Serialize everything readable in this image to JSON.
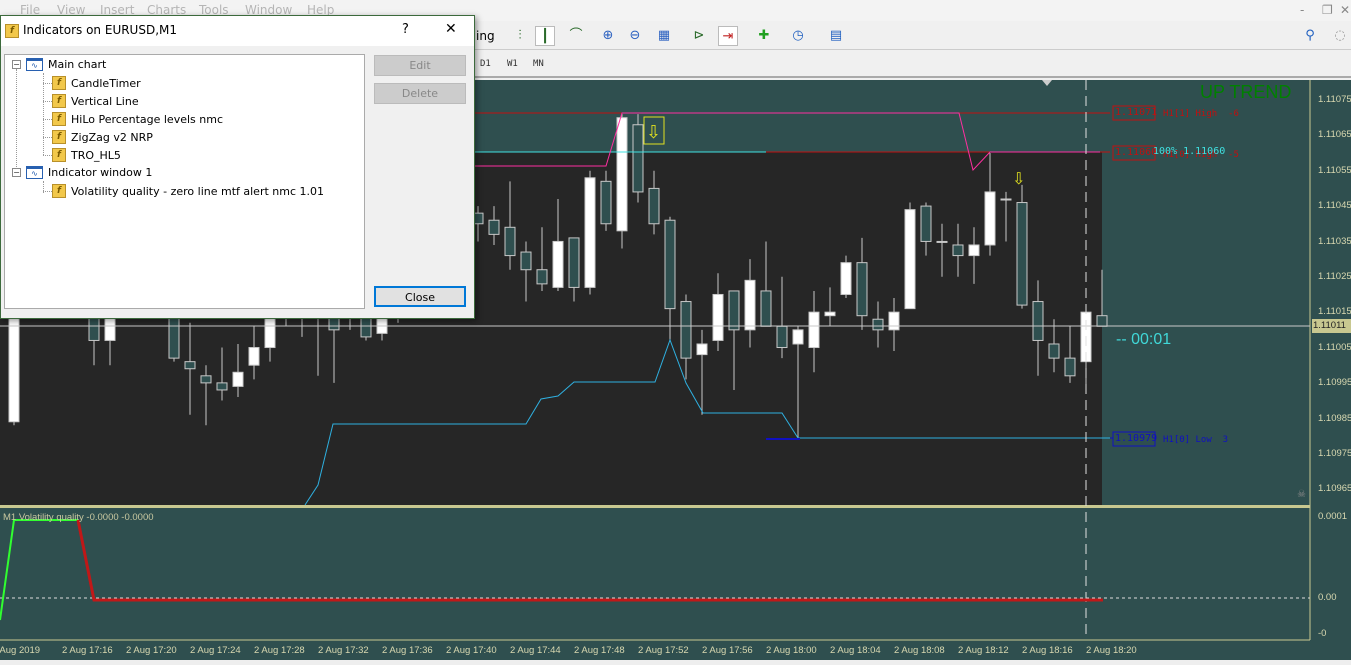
{
  "menu": {
    "items": [
      "File",
      "View",
      "Insert",
      "Charts",
      "Tools",
      "Window",
      "Help"
    ]
  },
  "toolbar": {
    "autotrading_fragment": "ing",
    "icons": [
      "bar-chart-icon",
      "candlestick-icon",
      "line-chart-icon",
      "zoom-in-icon",
      "zoom-out-icon",
      "tile-windows-icon",
      "chart-shift-icon",
      "autoscroll-icon",
      "new-indicator-icon",
      "periods-icon",
      "templates-icon",
      "search-icon",
      "community-icon"
    ]
  },
  "timeframes": [
    "D1",
    "W1",
    "MN"
  ],
  "dialog": {
    "title": "Indicators on EURUSD,M1",
    "help": "?",
    "close_x": "✕",
    "tree": [
      {
        "label": "Main chart",
        "children": [
          "CandleTimer",
          "Vertical Line",
          "HiLo Percentage levels nmc",
          "ZigZag v2 NRP",
          "TRO_HL5"
        ]
      },
      {
        "label": "Indicator window 1",
        "children": [
          "Volatility quality - zero line mtf alert nmc 1.01"
        ]
      }
    ],
    "edit": "Edit",
    "delete": "Delete",
    "close": "Close"
  },
  "chart": {
    "symbol": "EURUSD",
    "timeframe": "M1",
    "trend_label": "UP TREND",
    "timer": "-- 00:01",
    "levels": {
      "h1_1_high": {
        "price": "1.11071",
        "label": "H1[1] High  -6"
      },
      "h1_0_high": {
        "price": "1.11060",
        "label": "H1[0] High  -5"
      },
      "pct100": "100% 1.11060",
      "h1_0_low": {
        "price": "1.10979",
        "label": "H1[0] Low  3"
      }
    },
    "price_axis": [
      "1.11075",
      "1.11065",
      "1.11055",
      "1.11045",
      "1.11035",
      "1.11025",
      "1.11015",
      "1.11005",
      "1.10995",
      "1.10985",
      "1.10975",
      "1.10965"
    ],
    "current_price": "1.11011",
    "time_axis": [
      "2 Aug 2019",
      "2 Aug 17:16",
      "2 Aug 17:20",
      "2 Aug 17:24",
      "2 Aug 17:28",
      "2 Aug 17:32",
      "2 Aug 17:36",
      "2 Aug 17:40",
      "2 Aug 17:44",
      "2 Aug 17:48",
      "2 Aug 17:52",
      "2 Aug 17:56",
      "2 Aug 18:00",
      "2 Aug 18:04",
      "2 Aug 18:08",
      "2 Aug 18:12",
      "2 Aug 18:16",
      "2 Aug 18:20"
    ],
    "colors": {
      "bg_top": "#2f4f4f",
      "bg_dark": "#262626",
      "bull": "#ffffff",
      "bear": "#2f4f4f",
      "high_level": "#c01010",
      "low_level": "#1010c0",
      "zigzag": "#ff2fa0",
      "hilo": "#2fb0e0",
      "pct": "#40e0e0",
      "timer": "#40d8d8",
      "trend": "#008000",
      "vq_up": "#30ff30",
      "vq_down": "#c01818"
    },
    "candles": [
      [
        1.10984,
        1.11023,
        1.10983,
        1.1102
      ],
      [
        1.1102,
        1.1103,
        1.11015,
        1.11025
      ],
      [
        1.11025,
        1.11033,
        1.11018,
        1.11022
      ],
      [
        1.11022,
        1.1103,
        1.11016,
        1.11027
      ],
      [
        1.11027,
        1.11032,
        1.11019,
        1.1102
      ],
      [
        1.1102,
        1.11028,
        1.11,
        1.11007
      ],
      [
        1.11007,
        1.11022,
        1.11,
        1.11018
      ],
      [
        1.11018,
        1.1103,
        1.11015,
        1.11026
      ],
      [
        1.11026,
        1.11035,
        1.1102,
        1.1103
      ],
      [
        1.1103,
        1.11034,
        1.11022,
        1.11025
      ],
      [
        1.11025,
        1.1103,
        1.11001,
        1.11002
      ],
      [
        1.11001,
        1.11012,
        1.10986,
        1.10999
      ],
      [
        1.10997,
        1.11,
        1.10983,
        1.10995
      ],
      [
        1.10995,
        1.11005,
        1.1099,
        1.10993
      ],
      [
        1.10994,
        1.11006,
        1.10991,
        1.10998
      ],
      [
        1.11,
        1.11011,
        1.10996,
        1.11005
      ],
      [
        1.11005,
        1.11025,
        1.11001,
        1.1102
      ],
      [
        1.1102,
        1.11026,
        1.11011,
        1.11015
      ],
      [
        1.11015,
        1.11022,
        1.11008,
        1.11018
      ],
      [
        1.11018,
        1.11028,
        1.10997,
        1.11022
      ],
      [
        1.11024,
        1.1103,
        1.10995,
        1.1101
      ],
      [
        1.11015,
        1.11024,
        1.1101,
        1.1102
      ],
      [
        1.1102,
        1.11028,
        1.11007,
        1.11008
      ],
      [
        1.11009,
        1.11022,
        1.11007,
        1.11016
      ],
      [
        1.11016,
        1.1103,
        1.11012,
        1.11026
      ],
      [
        1.11026,
        1.11038,
        1.1102,
        1.11034
      ],
      [
        1.11034,
        1.1104,
        1.11025,
        1.1103
      ],
      [
        1.1103,
        1.11045,
        1.11028,
        1.11042
      ],
      [
        1.11042,
        1.11048,
        1.11036,
        1.11045
      ],
      [
        1.11043,
        1.11045,
        1.11035,
        1.1104
      ],
      [
        1.11041,
        1.11045,
        1.11034,
        1.11037
      ],
      [
        1.11039,
        1.11052,
        1.11027,
        1.11031
      ],
      [
        1.11032,
        1.11035,
        1.11018,
        1.11027
      ],
      [
        1.11027,
        1.11039,
        1.11021,
        1.11023
      ],
      [
        1.11022,
        1.11047,
        1.11021,
        1.11035
      ],
      [
        1.11036,
        1.11036,
        1.11018,
        1.11022
      ],
      [
        1.11022,
        1.11055,
        1.1102,
        1.11053
      ],
      [
        1.11052,
        1.11055,
        1.11038,
        1.1104
      ],
      [
        1.11038,
        1.11071,
        1.11033,
        1.1107
      ],
      [
        1.11068,
        1.11071,
        1.11046,
        1.11049
      ],
      [
        1.1105,
        1.11055,
        1.11037,
        1.1104
      ],
      [
        1.11041,
        1.11042,
        1.11007,
        1.11016
      ],
      [
        1.11018,
        1.1102,
        1.10996,
        1.11002
      ],
      [
        1.11003,
        1.1101,
        1.10986,
        1.11006
      ],
      [
        1.11007,
        1.11026,
        1.11004,
        1.1102
      ],
      [
        1.11021,
        1.11021,
        1.10993,
        1.1101
      ],
      [
        1.1101,
        1.1103,
        1.11005,
        1.11024
      ],
      [
        1.11021,
        1.11035,
        1.11011,
        1.11011
      ],
      [
        1.11011,
        1.11025,
        1.11002,
        1.11005
      ],
      [
        1.11006,
        1.11011,
        1.10979,
        1.1101
      ],
      [
        1.11005,
        1.11021,
        1.10998,
        1.11015
      ],
      [
        1.11014,
        1.11022,
        1.11011,
        1.11015
      ],
      [
        1.1102,
        1.11031,
        1.11019,
        1.11029
      ],
      [
        1.11029,
        1.11036,
        1.1101,
        1.11014
      ],
      [
        1.11013,
        1.11018,
        1.11005,
        1.1101
      ],
      [
        1.1101,
        1.11019,
        1.11004,
        1.11015
      ],
      [
        1.11016,
        1.11046,
        1.11016,
        1.11044
      ],
      [
        1.11045,
        1.11046,
        1.11031,
        1.11035
      ],
      [
        1.11035,
        1.1104,
        1.11025,
        1.11035
      ],
      [
        1.11034,
        1.1104,
        1.11025,
        1.11031
      ],
      [
        1.11031,
        1.11039,
        1.11023,
        1.11034
      ],
      [
        1.11034,
        1.1106,
        1.11031,
        1.11049
      ],
      [
        1.11047,
        1.11049,
        1.11035,
        1.11047
      ],
      [
        1.11046,
        1.11051,
        1.11016,
        1.11017
      ],
      [
        1.11018,
        1.11024,
        1.10997,
        1.11007
      ],
      [
        1.11006,
        1.11013,
        1.10998,
        1.11002
      ],
      [
        1.11002,
        1.11011,
        1.10995,
        1.10997
      ],
      [
        1.11001,
        1.11015,
        1.10994,
        1.11015
      ],
      [
        1.11014,
        1.11027,
        1.11011,
        1.11011
      ]
    ]
  },
  "indicator": {
    "label": "M1 Volatility quality -0.0000 -0.0000",
    "axis": [
      "0.0001",
      "0.00",
      "-0"
    ]
  }
}
